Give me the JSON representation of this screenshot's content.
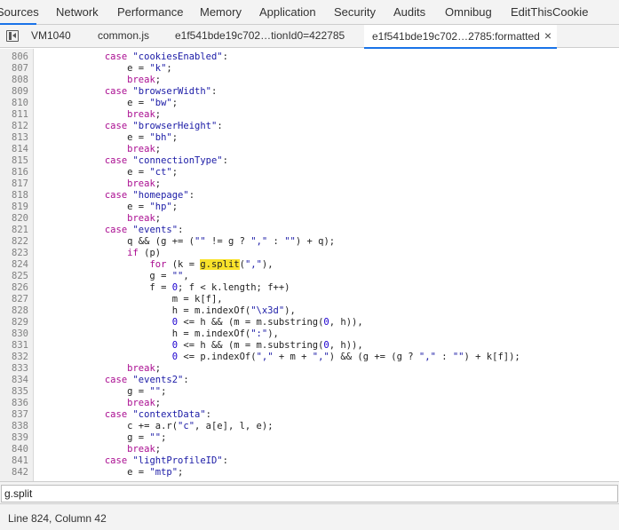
{
  "panel_tabs": [
    "Sources",
    "Network",
    "Performance",
    "Memory",
    "Application",
    "Security",
    "Audits",
    "Omnibug",
    "EditThisCookie"
  ],
  "file_tabs": [
    "VM1040",
    "common.js",
    "e1f541bde19c702…tionId0=422785",
    "e1f541bde19c702…2785:formatted"
  ],
  "close_glyph": "×",
  "code_lines": [
    {
      "n": "806",
      "t": "            case \"cookiesEnabled\":"
    },
    {
      "n": "807",
      "t": "                e = \"k\";"
    },
    {
      "n": "808",
      "t": "                break;"
    },
    {
      "n": "809",
      "t": "            case \"browserWidth\":"
    },
    {
      "n": "810",
      "t": "                e = \"bw\";"
    },
    {
      "n": "811",
      "t": "                break;"
    },
    {
      "n": "812",
      "t": "            case \"browserHeight\":"
    },
    {
      "n": "813",
      "t": "                e = \"bh\";"
    },
    {
      "n": "814",
      "t": "                break;"
    },
    {
      "n": "815",
      "t": "            case \"connectionType\":"
    },
    {
      "n": "816",
      "t": "                e = \"ct\";"
    },
    {
      "n": "817",
      "t": "                break;"
    },
    {
      "n": "818",
      "t": "            case \"homepage\":"
    },
    {
      "n": "819",
      "t": "                e = \"hp\";"
    },
    {
      "n": "820",
      "t": "                break;"
    },
    {
      "n": "821",
      "t": "            case \"events\":"
    },
    {
      "n": "822",
      "t": "                q && (g += (\"\" != g ? \",\" : \"\") + q);"
    },
    {
      "n": "823",
      "t": "                if (p)"
    },
    {
      "n": "824",
      "t": "                    for (k = g.split(\",\"),"
    },
    {
      "n": "825",
      "t": "                    g = \"\","
    },
    {
      "n": "826",
      "t": "                    f = 0; f < k.length; f++)"
    },
    {
      "n": "827",
      "t": "                        m = k[f],"
    },
    {
      "n": "828",
      "t": "                        h = m.indexOf(\"\\x3d\"),"
    },
    {
      "n": "829",
      "t": "                        0 <= h && (m = m.substring(0, h)),"
    },
    {
      "n": "830",
      "t": "                        h = m.indexOf(\":\"),"
    },
    {
      "n": "831",
      "t": "                        0 <= h && (m = m.substring(0, h)),"
    },
    {
      "n": "832",
      "t": "                        0 <= p.indexOf(\",\" + m + \",\") && (g += (g ? \",\" : \"\") + k[f]);"
    },
    {
      "n": "833",
      "t": "                break;"
    },
    {
      "n": "834",
      "t": "            case \"events2\":"
    },
    {
      "n": "835",
      "t": "                g = \"\";"
    },
    {
      "n": "836",
      "t": "                break;"
    },
    {
      "n": "837",
      "t": "            case \"contextData\":"
    },
    {
      "n": "838",
      "t": "                c += a.r(\"c\", a[e], l, e);"
    },
    {
      "n": "839",
      "t": "                g = \"\";"
    },
    {
      "n": "840",
      "t": "                break;"
    },
    {
      "n": "841",
      "t": "            case \"lightProfileID\":"
    },
    {
      "n": "842",
      "t": "                e = \"mtp\";"
    }
  ],
  "highlight_term": "g.split",
  "search": {
    "value": "g.split"
  },
  "status": {
    "text": "Line 824, Column 42"
  },
  "colors": {
    "accent": "#1a73e8",
    "keyword": "#aa0d91",
    "string": "#1a1aa6",
    "number": "#1c00cf",
    "highlight": "#f9e22a"
  }
}
